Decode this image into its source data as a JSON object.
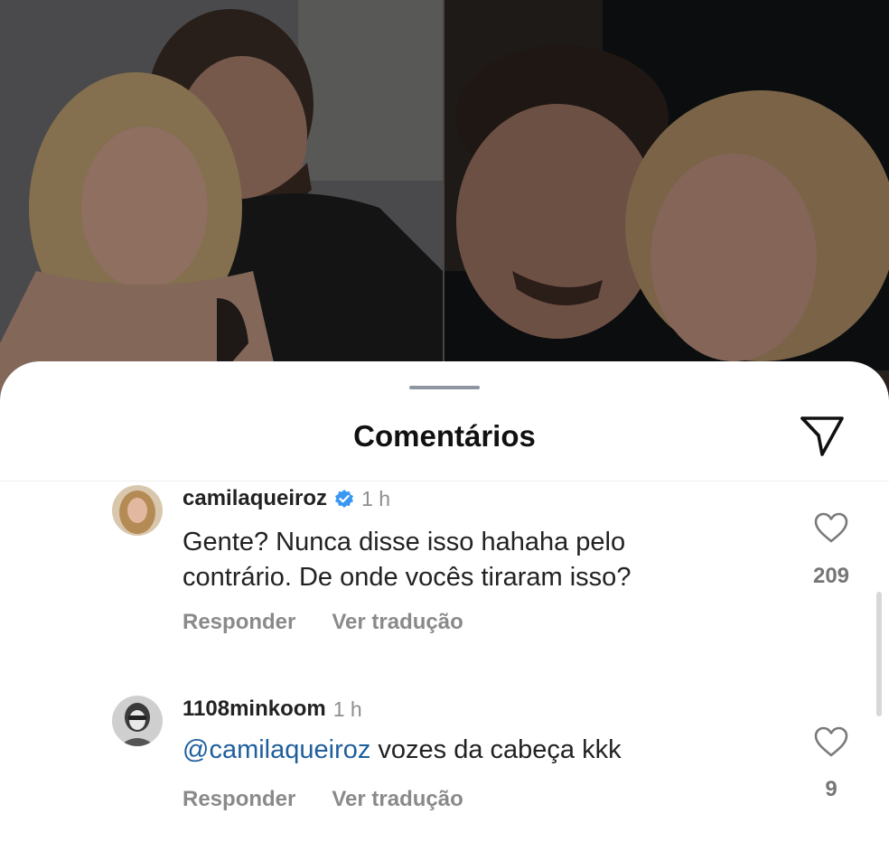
{
  "sheet": {
    "title": "Comentários"
  },
  "comments": [
    {
      "username": "camilaqueiroz",
      "verified": true,
      "time": "1 h",
      "text_lines": [
        "Gente? Nunca disse isso hahaha pelo",
        "contrário. De onde vocês tiraram isso?"
      ],
      "like_count": "209",
      "reply_label": "Responder",
      "translate_label": "Ver tradução"
    },
    {
      "username": "1108minkoom",
      "verified": false,
      "time": "1 h",
      "mention": "@camilaqueiroz",
      "text": "vozes da cabeça kkk",
      "like_count": "9",
      "reply_label": "Responder",
      "translate_label": "Ver tradução"
    }
  ],
  "colors": {
    "mention": "#1e5f9c",
    "verified": "#3897f0",
    "secondary_text": "#8a8a8a"
  },
  "icons": [
    "share-icon",
    "verified-icon",
    "heart-icon"
  ]
}
